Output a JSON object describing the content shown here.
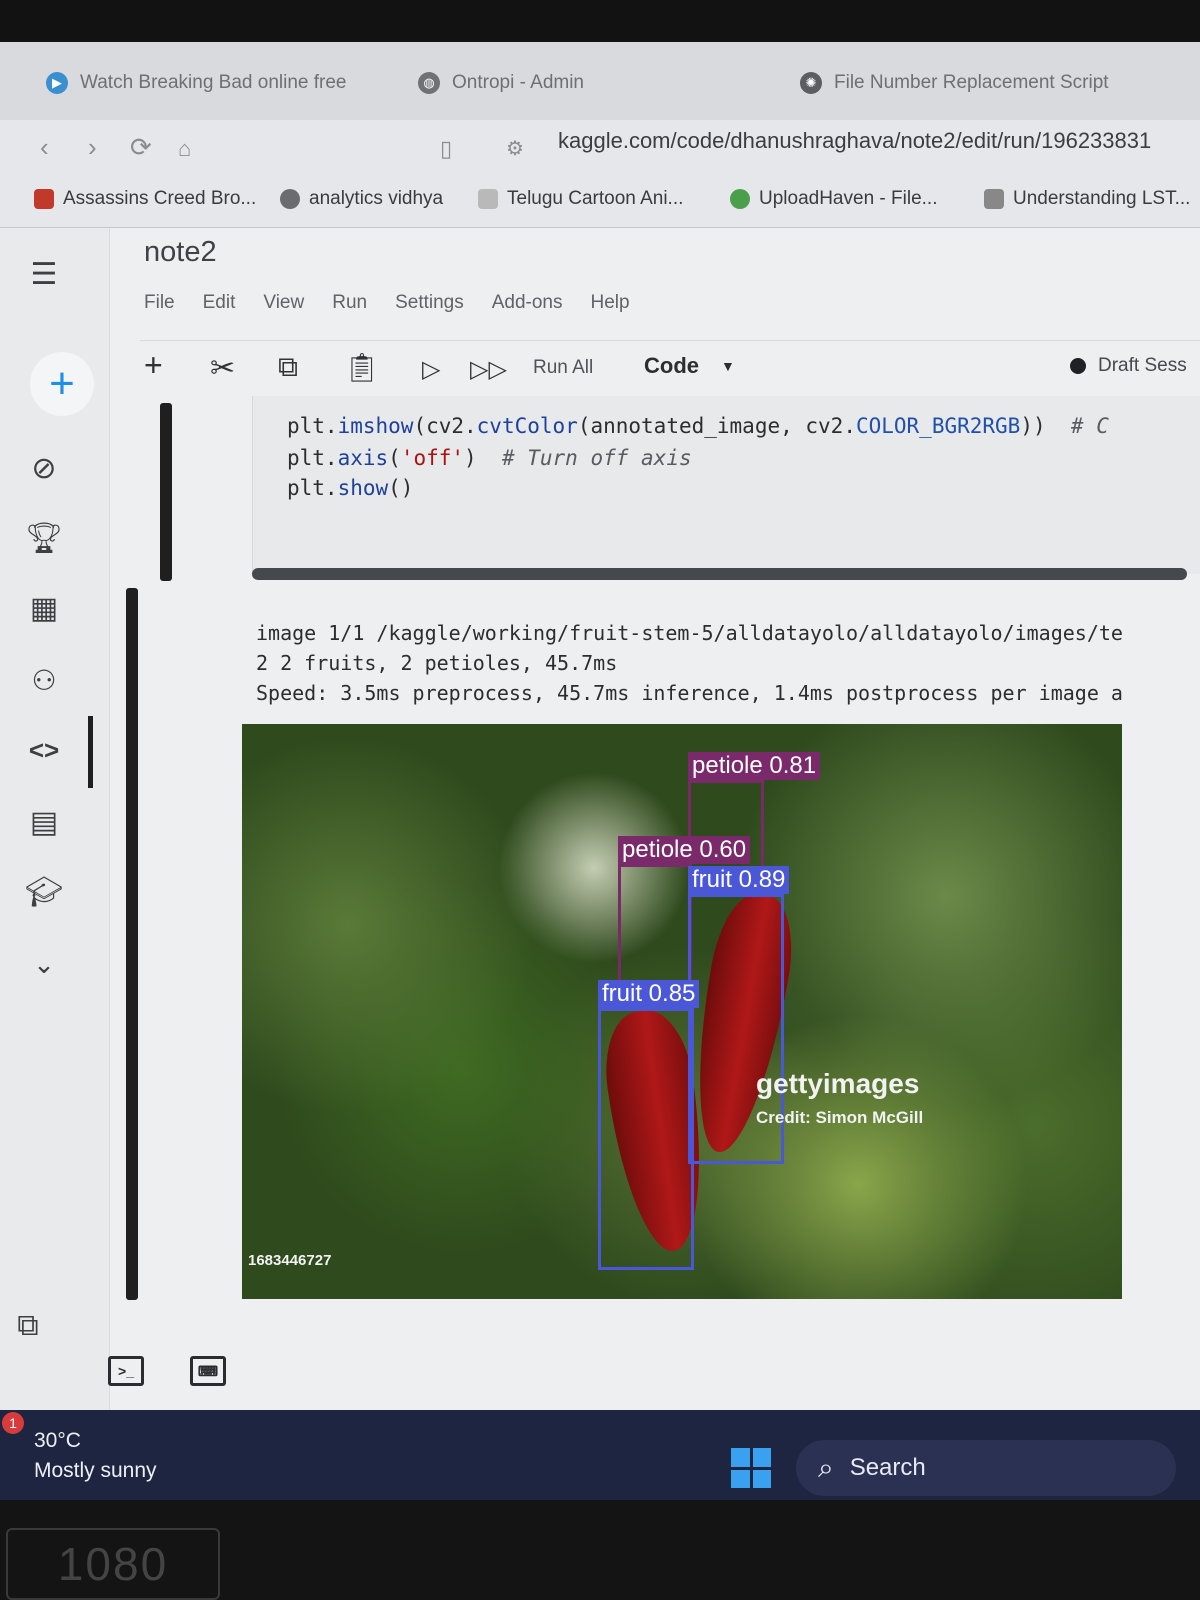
{
  "browser": {
    "tabs": [
      {
        "label": "Watch Breaking Bad online free",
        "icon": "play-icon"
      },
      {
        "label": "Ontropi - Admin",
        "icon": "globe-icon"
      },
      {
        "label": "File Number Replacement Script",
        "icon": "openai-icon"
      }
    ],
    "url": "kaggle.com/code/dhanushraghava/note2/edit/run/196233831",
    "bookmarks": [
      {
        "label": "Assassins Creed Bro...",
        "color": "#c0392b"
      },
      {
        "label": "analytics vidhya",
        "color": "#6a6c70"
      },
      {
        "label": "Telugu Cartoon Ani...",
        "color": "#b9b9b9"
      },
      {
        "label": "UploadHaven - File...",
        "color": "#4aa04a"
      },
      {
        "label": "Understanding LST...",
        "color": "#888888"
      }
    ]
  },
  "notebook": {
    "title": "note2",
    "menu": [
      "File",
      "Edit",
      "View",
      "Run",
      "Settings",
      "Add-ons",
      "Help"
    ],
    "toolbar": {
      "run_all": "Run All",
      "cell_type": "Code",
      "session": "Draft Sess"
    },
    "code_lines": {
      "line1_a": "plt.",
      "line1_fn": "imshow",
      "line1_b": "(cv2.",
      "line1_fn2": "cvtColor",
      "line1_c": "(annotated_image, cv2.",
      "line1_const": "COLOR_BGR2RGB",
      "line1_d": "))  ",
      "line1_cm": "# C",
      "line2_a": "plt.",
      "line2_fn": "axis",
      "line2_b": "(",
      "line2_str": "'off'",
      "line2_c": ")  ",
      "line2_cm": "# Turn off axis",
      "line3_a": "plt.",
      "line3_fn": "show",
      "line3_b": "()"
    },
    "output": {
      "line1": "image 1/1 /kaggle/working/fruit-stem-5/alldatayolo/alldatayolo/images/te",
      "line2": "2 2 fruits, 2 petioles, 45.7ms",
      "line3": "Speed: 3.5ms preprocess, 45.7ms inference, 1.4ms postprocess per image a"
    },
    "detections": [
      {
        "label": "petiole 0.81",
        "color": "#7a2a6a"
      },
      {
        "label": "petiole 0.60",
        "color": "#7a2a6a"
      },
      {
        "label": "fruit 0.89",
        "color": "#4a58d8"
      },
      {
        "label": "fruit 0.85",
        "color": "#4a58d8"
      }
    ],
    "image_text": {
      "brand": "gettyimages",
      "credit": "Credit: Simon McGill",
      "id": "1683446727"
    }
  },
  "taskbar": {
    "temp": "30°C",
    "weather": "Mostly sunny",
    "notification_count": "1",
    "search_label": "Search"
  },
  "monitor": {
    "label": "1080"
  }
}
